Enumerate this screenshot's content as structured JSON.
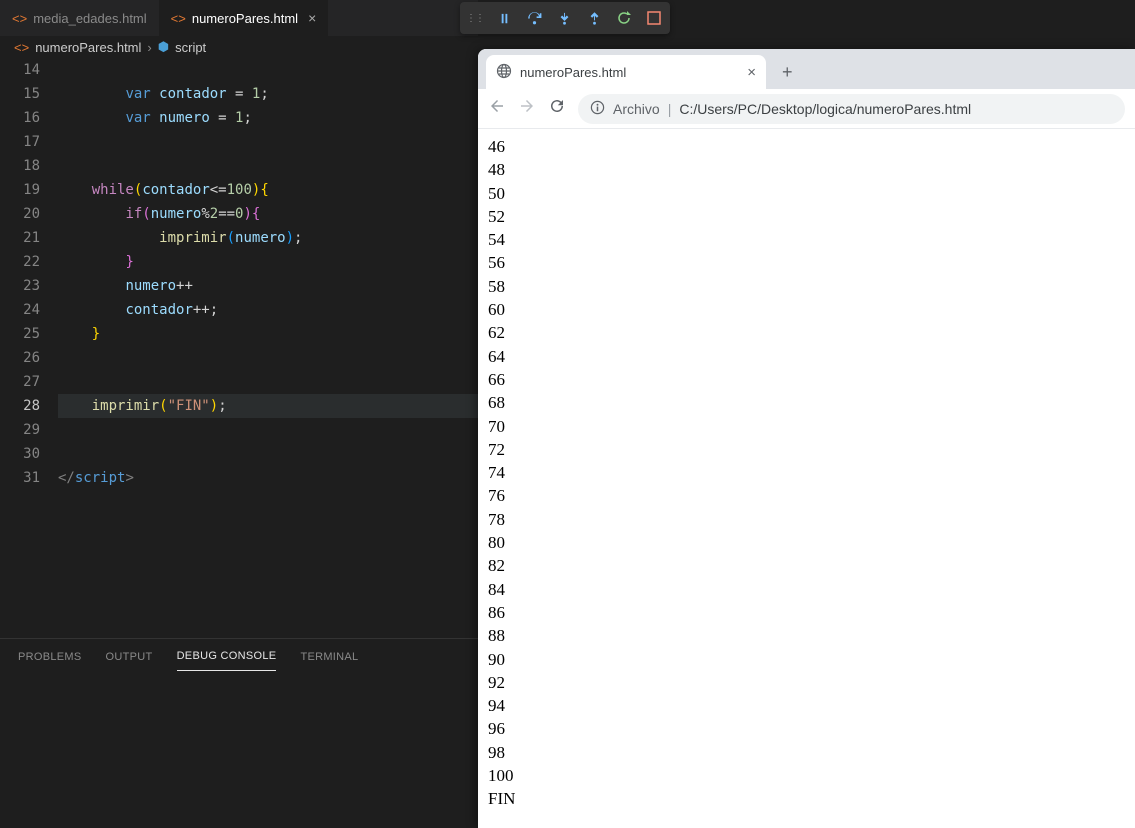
{
  "tabs": {
    "inactive": "media_edades.html",
    "active": "numeroPares.html"
  },
  "breadcrumb": {
    "file": "numeroPares.html",
    "symbol": "script"
  },
  "line_numbers": [
    14,
    15,
    16,
    17,
    18,
    19,
    20,
    21,
    22,
    23,
    24,
    25,
    26,
    27,
    28,
    29,
    30,
    31
  ],
  "current_line": 28,
  "code": {
    "l15_kw": "var",
    "l15_var": "contador",
    "l15_eq": " = ",
    "l15_num": "1",
    "l15_semi": ";",
    "l16_kw": "var",
    "l16_var": "numero",
    "l16_eq": " = ",
    "l16_num": "1",
    "l16_semi": ";",
    "l19_while": "while",
    "l19_po": "(",
    "l19_v1": "contador",
    "l19_op": "<=",
    "l19_n": "100",
    "l19_pc": ")",
    "l19_bo": "{",
    "l20_if": "if",
    "l20_po": "(",
    "l20_v": "numero",
    "l20_op": "%",
    "l20_n2": "2",
    "l20_eq": "==",
    "l20_z": "0",
    "l20_pc": ")",
    "l20_bo": "{",
    "l21_fn": "imprimir",
    "l21_po": "(",
    "l21_v": "numero",
    "l21_pc": ")",
    "l21_semi": ";",
    "l22_bc": "}",
    "l23_v": "numero",
    "l23_pp": "++",
    "l24_v": "contador",
    "l24_pp": "++",
    "l24_semi": ";",
    "l25_bc": "}",
    "l28_fn": "imprimir",
    "l28_po": "(",
    "l28_str": "\"FIN\"",
    "l28_pc": ")",
    "l28_semi": ";",
    "l31_lt": "</",
    "l31_tag": "script",
    "l31_gt": ">"
  },
  "panel_tabs": {
    "problems": "PROBLEMS",
    "output": "OUTPUT",
    "debug": "DEBUG CONSOLE",
    "terminal": "TERMINAL"
  },
  "browser": {
    "tab_title": "numeroPares.html",
    "addr_label": "Archivo",
    "addr_path": "C:/Users/PC/Desktop/logica/numeroPares.html",
    "output": [
      "46",
      "48",
      "50",
      "52",
      "54",
      "56",
      "58",
      "60",
      "62",
      "64",
      "66",
      "68",
      "70",
      "72",
      "74",
      "76",
      "78",
      "80",
      "82",
      "84",
      "86",
      "88",
      "90",
      "92",
      "94",
      "96",
      "98",
      "100",
      "FIN"
    ]
  }
}
